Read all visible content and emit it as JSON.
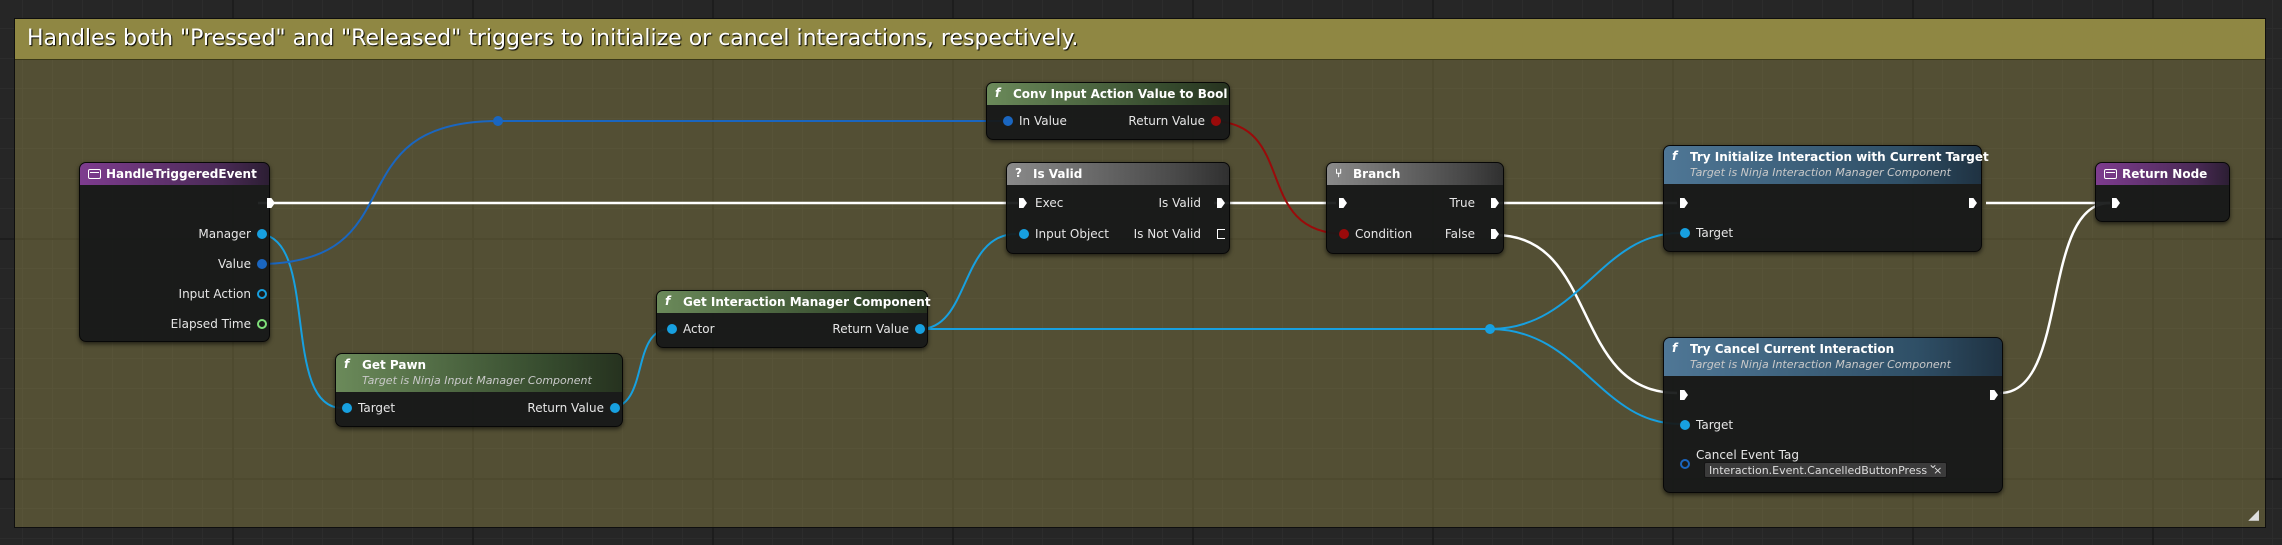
{
  "comment": {
    "title": "Handles both \"Pressed\" and \"Released\" triggers to initialize or cancel interactions, respectively."
  },
  "colors": {
    "comment_bar": "#8f8743",
    "exec_wire": "#ffffff",
    "object_wire": "#17a0e0",
    "struct_wire": "#1a66c0",
    "bool_wire": "#9a0a0a"
  },
  "nodes": {
    "event": {
      "title": "HandleTriggeredEvent",
      "pins": {
        "manager": "Manager",
        "value": "Value",
        "input_action": "Input Action",
        "elapsed_time": "Elapsed Time"
      }
    },
    "get_pawn": {
      "title": "Get Pawn",
      "subtitle": "Target is Ninja Input Manager Component",
      "pins": {
        "target": "Target",
        "return_value": "Return Value"
      }
    },
    "get_interaction_manager": {
      "title": "Get Interaction Manager Component",
      "pins": {
        "actor": "Actor",
        "return_value": "Return Value"
      }
    },
    "conv_bool": {
      "title": "Conv Input Action Value to Bool",
      "pins": {
        "in_value": "In Value",
        "return_value": "Return Value"
      }
    },
    "is_valid": {
      "title": "Is Valid",
      "icon": "?",
      "pins": {
        "exec": "Exec",
        "input_object": "Input Object",
        "is_valid": "Is Valid",
        "is_not_valid": "Is Not Valid"
      }
    },
    "branch": {
      "title": "Branch",
      "pins": {
        "condition": "Condition",
        "true": "True",
        "false": "False"
      }
    },
    "try_initialize": {
      "title": "Try Initialize Interaction with Current Target",
      "subtitle": "Target is Ninja Interaction Manager Component",
      "pins": {
        "target": "Target"
      }
    },
    "try_cancel": {
      "title": "Try Cancel Current Interaction",
      "subtitle": "Target is Ninja Interaction Manager Component",
      "pins": {
        "target": "Target",
        "cancel_event_tag": "Cancel Event Tag"
      },
      "cancel_tag_value": "Interaction.Event.CancelledButtonPress"
    },
    "return_node": {
      "title": "Return Node"
    }
  },
  "icons": {
    "function": "f",
    "event": "event-icon",
    "branch": "branch-icon",
    "clear": "×",
    "dropdown": "⌄",
    "resize": "◢"
  }
}
